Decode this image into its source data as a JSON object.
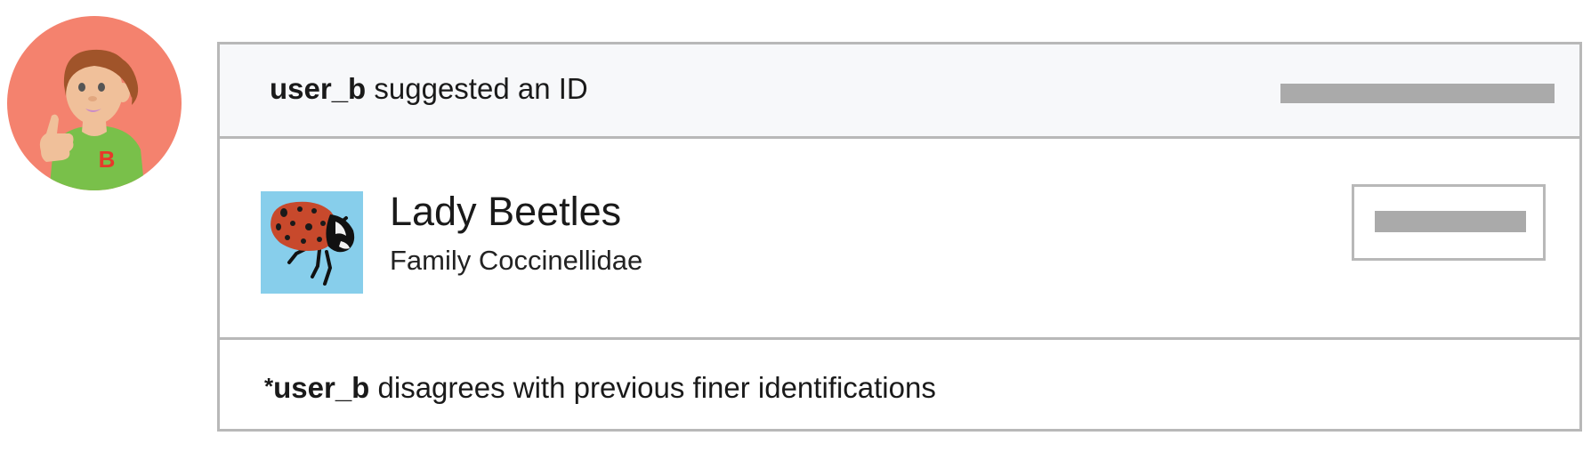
{
  "avatar": {
    "badge_letter": "B",
    "circle_color": "#f4826e",
    "shirt_color": "#79c04a",
    "icon": "user-avatar-illustration"
  },
  "suggestion_card": {
    "header": {
      "username": "user_b",
      "action_text": "suggested an ID",
      "background": "#f7f8fa"
    },
    "taxon": {
      "common_name": "Lady Beetles",
      "rank_and_name": "Family Coccinellidae",
      "photo_icon": "lady-beetle-photo",
      "photo_background": "#87ceeb"
    },
    "footer": {
      "marker": "*",
      "username": "user_b",
      "message": "disagrees with previous finer identifications"
    },
    "border_color": "#b8b8b8",
    "placeholder_color": "#aaaaaa"
  }
}
